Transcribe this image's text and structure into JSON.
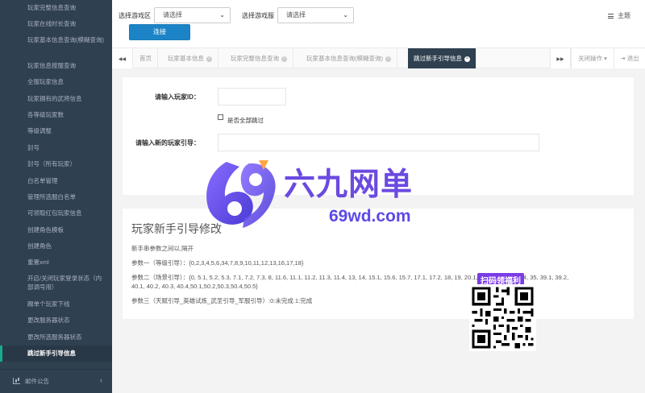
{
  "sidebar": {
    "items": [
      {
        "label": "玩家完整信息查询"
      },
      {
        "label": "玩家在线时长查询"
      },
      {
        "label": "玩家基本信息查询(模糊查询)",
        "tall": true
      },
      {
        "label": "玩家信息按服查询"
      },
      {
        "label": "全服玩家信息"
      },
      {
        "label": "玩家拥有的武将信息"
      },
      {
        "label": "各等级玩家数"
      },
      {
        "label": "等级调整"
      },
      {
        "label": "封号"
      },
      {
        "label": "封号（所有玩家）"
      },
      {
        "label": "白名单管理"
      },
      {
        "label": "管理所选服白名单"
      },
      {
        "label": "可领取红包玩家信息"
      },
      {
        "label": "创建角色模板"
      },
      {
        "label": "创建角色"
      },
      {
        "label": "重置xml"
      },
      {
        "label": "开启/关闭玩家登录状态（内部调号用）",
        "tall": true
      },
      {
        "label": "踢单个玩家下线"
      },
      {
        "label": "更改服务器状态"
      },
      {
        "label": "更改所选服务器状态"
      },
      {
        "label": "跳过新手引导信息",
        "active": true
      }
    ],
    "footer_label": "邮件公告",
    "footer_chevron": "‹"
  },
  "topbar": {
    "region_label": "选择游戏区",
    "region_value": "请选择",
    "server_label": "选择游戏服",
    "server_value": "请选择",
    "connect_label": "连接",
    "theme_label": "主题",
    "select_arrow": "⌄"
  },
  "tabs": {
    "prev_icon": "◀◀",
    "next_icon": "▶▶",
    "items": [
      {
        "label": "首页",
        "closable": false
      },
      {
        "label": "玩家基本信息",
        "closable": true
      },
      {
        "label": "玩家完整信息查询",
        "closable": true
      },
      {
        "label": "玩家基本信息查询(模糊查询)",
        "closable": true
      },
      {
        "label": "跳过新手引导信息",
        "closable": true,
        "active": true
      }
    ],
    "close_glyph": "×",
    "close_ops_label": "关闭操作",
    "close_ops_arrow": "▾",
    "logout_label": "退出",
    "logout_icon": "⇥"
  },
  "form": {
    "player_id_label": "请输入玩家ID：",
    "skip_all_label": "是否全部跳过",
    "new_guide_label": "请输入新的玩家引导："
  },
  "info": {
    "title": "玩家新手引导修改",
    "lines": [
      "新手串参数之间以,隔开",
      "参数一（等级引导）：{0,2,3,4,5,6,34,7,8,9,10,11,12,13,16,17,18}",
      "参数二（场景引导）：{0, 5.1, 5.2, 5.3, 7.1, 7.2, 7.3, 8, 11.6, 11.1, 11.2, 11.3, 11.4, 13, 14, 15.1, 15.6, 15.7, 17.1, 17.2, 18, 19, 20.1, 22, 23, 25, 30, 34, 35, 39.1, 39.2,",
      "40.1, 40.2, 40.3, 40.4,50.1,50.2,50.3,50.4,50.5}",
      "参数三（天赋引导_英雄试炼_武圣引导_军服引导）:0:未完成  1:完成"
    ]
  },
  "watermark": {
    "brand_cn": "六九网单",
    "brand_en": "69wd.com",
    "qr_label": "扫码领福利",
    "logo_color": "#6a4ce6"
  }
}
